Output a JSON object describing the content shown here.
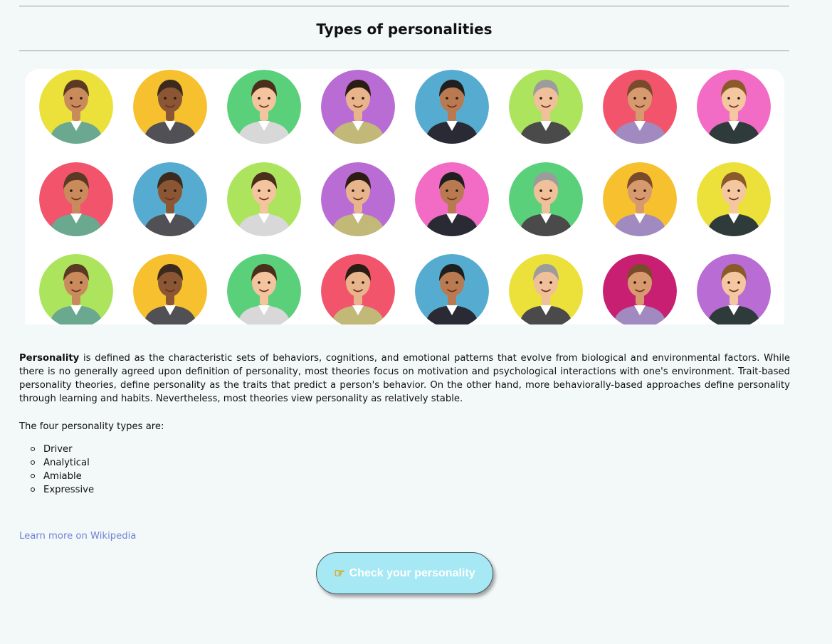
{
  "header": {
    "title": "Types of personalities"
  },
  "avatars": {
    "rows": [
      [
        "#ece03b",
        "#f6c02e",
        "#5bd07a",
        "#b86cd4",
        "#56acd0",
        "#ade45d",
        "#f2556b",
        "#f26bc4"
      ],
      [
        "#f2556b",
        "#56acd0",
        "#ade45d",
        "#b86cd4",
        "#f26bc4",
        "#5bd07a",
        "#f6c02e",
        "#ece03b"
      ],
      [
        "#ade45d",
        "#f6c02e",
        "#5bd07a",
        "#f2556b",
        "#56acd0",
        "#ece03b",
        "#c91f72",
        "#b86cd4"
      ]
    ]
  },
  "content": {
    "description_bold": "Personality",
    "description_rest": " is defined as the characteristic sets of behaviors, cognitions, and emotional patterns that evolve from biological and environmental factors. While there is no generally agreed upon definition of personality, most theories focus on motivation and psychological interactions with one's environment. Trait-based personality theories, define personality as the traits that predict a person's behavior. On the other hand, more behaviorally-based approaches define personality through learning and habits. Nevertheless, most theories view personality as relatively stable.",
    "types_intro": "The four personality types are:",
    "types": [
      "Driver",
      "Analytical",
      "Amiable",
      "Expressive"
    ]
  },
  "links": {
    "wikipedia": "Learn more on Wikipedia"
  },
  "cta": {
    "icon": "hand-pointing-right-icon",
    "label": "Check your personality"
  }
}
